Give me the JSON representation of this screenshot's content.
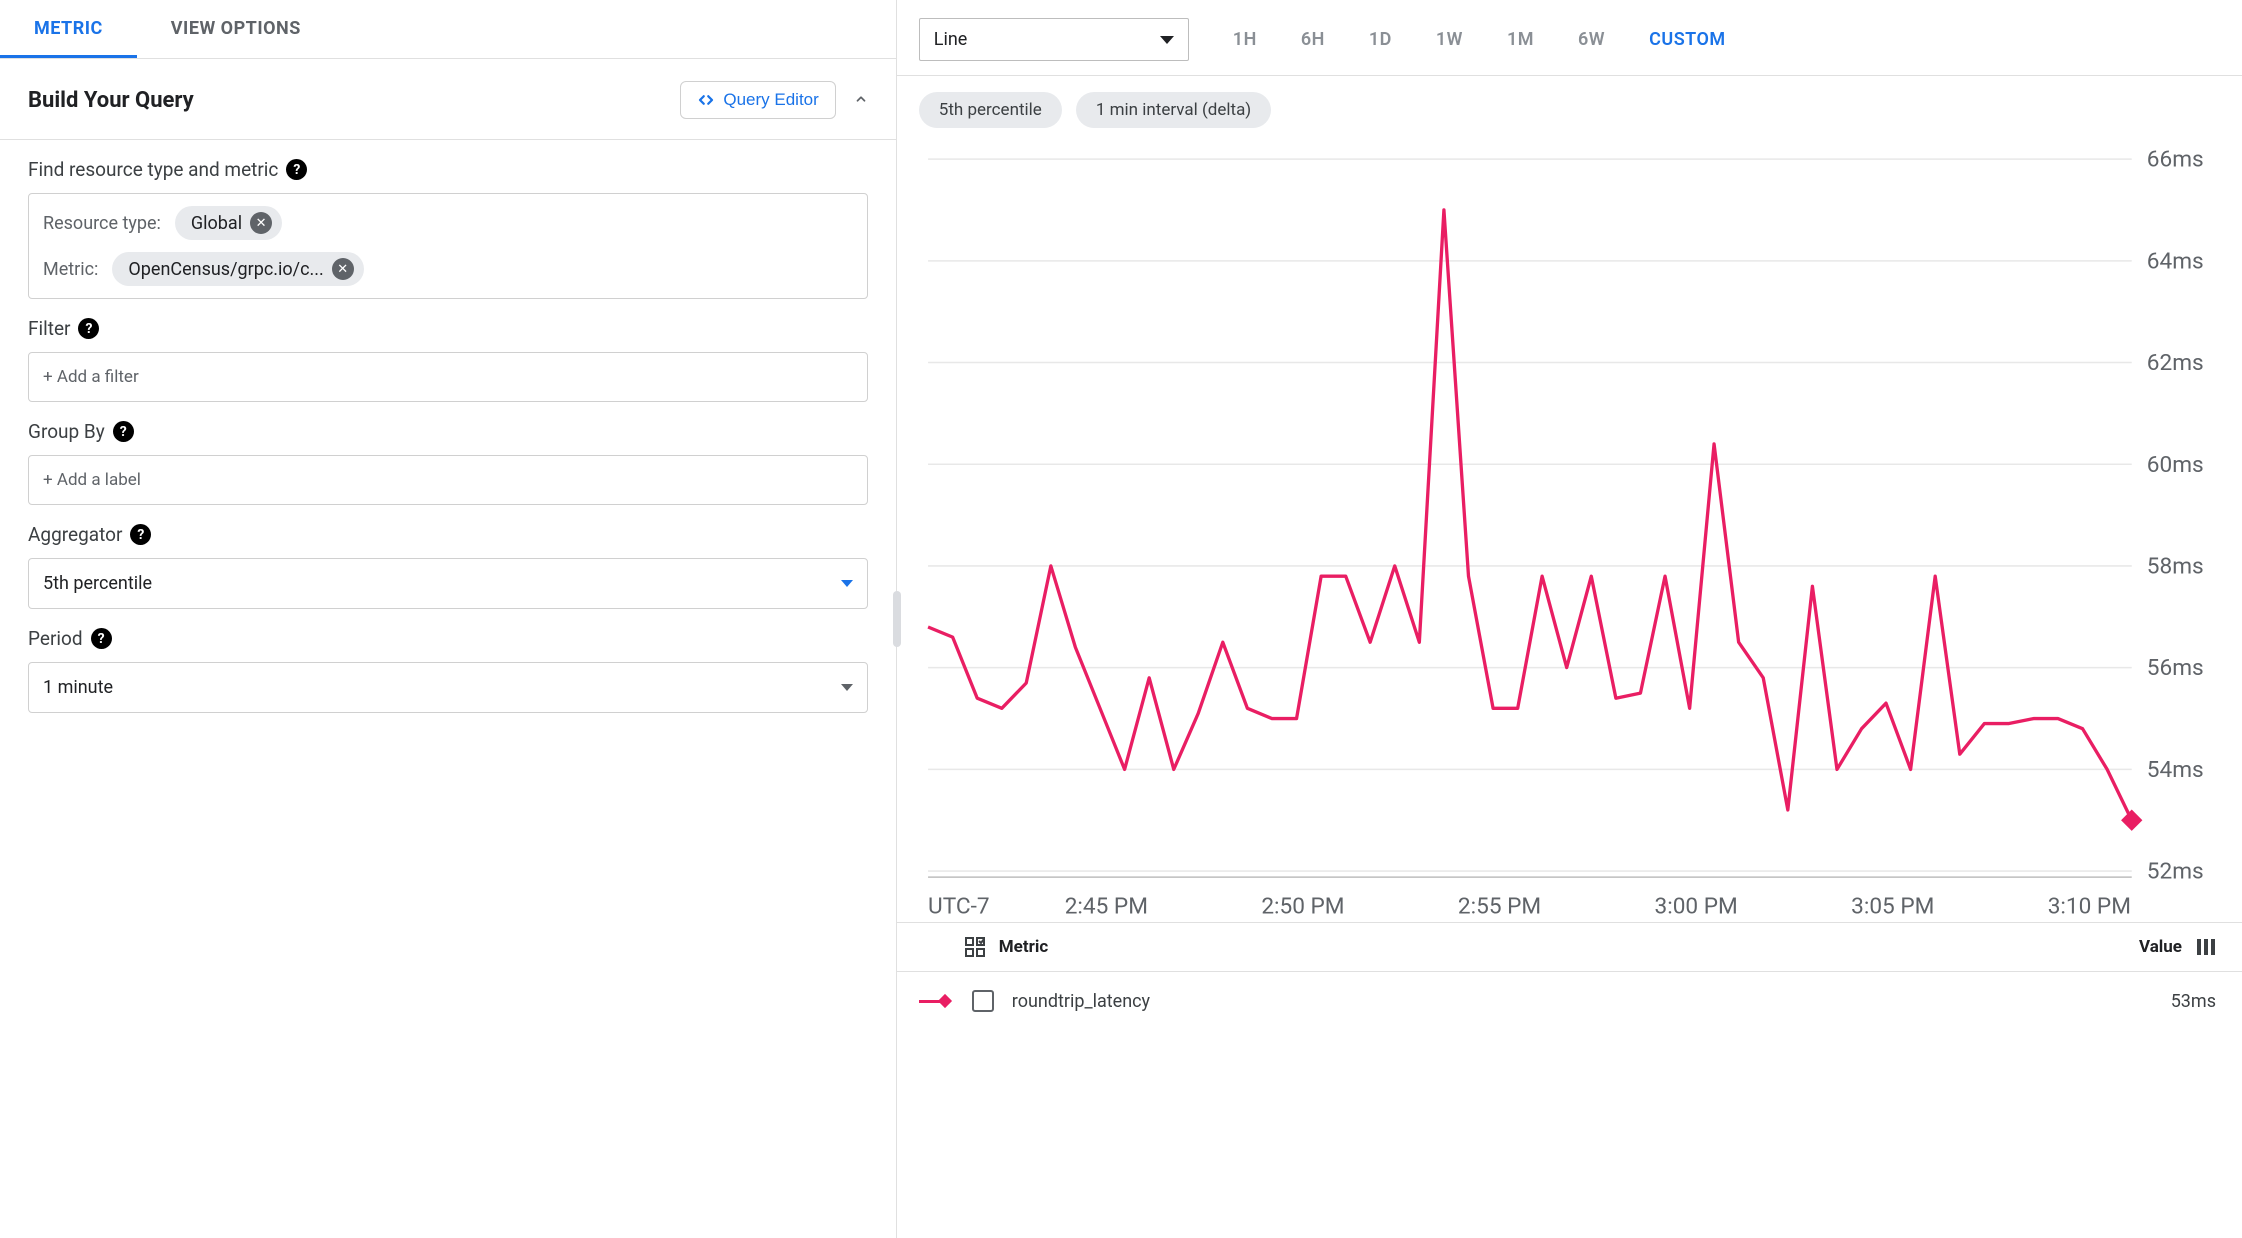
{
  "tabs": {
    "metric": "METRIC",
    "view_options": "VIEW OPTIONS",
    "active": "metric"
  },
  "section": {
    "title": "Build Your Query",
    "query_editor_btn": "Query Editor"
  },
  "form": {
    "find_label": "Find resource type and metric",
    "resource_type_label": "Resource type:",
    "resource_type_chip": "Global",
    "metric_label": "Metric:",
    "metric_chip": "OpenCensus/grpc.io/c...",
    "filter_label": "Filter",
    "filter_placeholder": "+ Add a filter",
    "group_by_label": "Group By",
    "group_by_placeholder": "+ Add a label",
    "aggregator_label": "Aggregator",
    "aggregator_value": "5th percentile",
    "period_label": "Period",
    "period_value": "1 minute"
  },
  "chart_controls": {
    "chart_type": "Line",
    "time_ranges": [
      "1H",
      "6H",
      "1D",
      "1W",
      "1M",
      "6W",
      "CUSTOM"
    ],
    "time_range_active": "CUSTOM",
    "pills": [
      "5th percentile",
      "1 min interval (delta)"
    ]
  },
  "legend": {
    "metric_header": "Metric",
    "value_header": "Value",
    "series_name": "roundtrip_latency",
    "series_value": "53ms"
  },
  "chart_data": {
    "type": "line",
    "title": "",
    "xlabel": "",
    "ylabel": "",
    "y_unit": "ms",
    "ylim": [
      52,
      66
    ],
    "y_ticks": [
      52,
      54,
      56,
      58,
      60,
      62,
      64,
      66
    ],
    "x_timezone_label": "UTC-7",
    "x_tick_labels": [
      "2:45 PM",
      "2:50 PM",
      "2:55 PM",
      "3:00 PM",
      "3:05 PM",
      "3:10 PM"
    ],
    "series": [
      {
        "name": "roundtrip_latency",
        "color": "#e91e63",
        "values": [
          56.8,
          56.6,
          55.4,
          55.2,
          55.7,
          58.0,
          56.4,
          55.2,
          54.0,
          55.8,
          54.0,
          55.1,
          56.5,
          55.2,
          55.0,
          55.0,
          57.8,
          57.8,
          56.5,
          58.0,
          56.5,
          65.0,
          57.8,
          55.2,
          55.2,
          57.8,
          56.0,
          57.8,
          55.4,
          55.5,
          57.8,
          55.2,
          60.4,
          56.5,
          55.8,
          53.2,
          57.6,
          54.0,
          54.8,
          55.3,
          54.0,
          57.8,
          54.3,
          54.9,
          54.9,
          55.0,
          55.0,
          54.8,
          54.0,
          53.0
        ]
      }
    ]
  }
}
